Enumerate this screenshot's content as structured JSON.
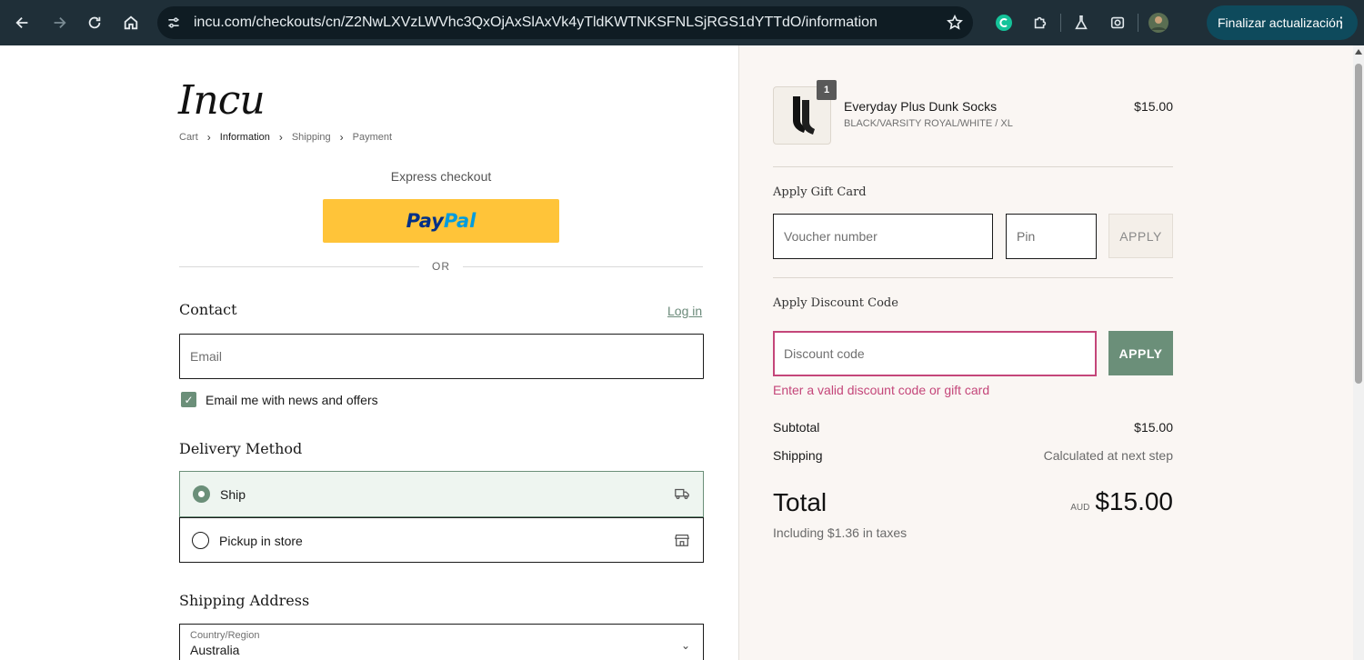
{
  "browser": {
    "url": "incu.com/checkouts/cn/Z2NwLXVzLWVhc3QxOjAxSlAxVk4yTldKWTNKSFNLSjRGS1dYTTdO/information",
    "update_label": "Finalizar actualización"
  },
  "brand": {
    "logo_text": "Incu"
  },
  "breadcrumb": [
    "Cart",
    "Information",
    "Shipping",
    "Payment"
  ],
  "express": {
    "label": "Express checkout",
    "paypal_pay": "Pay",
    "paypal_pal": "Pal",
    "or": "OR"
  },
  "contact": {
    "heading": "Contact",
    "login_label": "Log in",
    "email_placeholder": "Email",
    "newsletter_label": "Email me with news and offers",
    "newsletter_checked": true
  },
  "delivery": {
    "heading": "Delivery Method",
    "options": [
      {
        "label": "Ship",
        "selected": true,
        "icon": "truck-icon"
      },
      {
        "label": "Pickup in store",
        "selected": false,
        "icon": "store-icon"
      }
    ]
  },
  "shipping": {
    "heading": "Shipping Address",
    "country_label": "Country/Region",
    "country_value": "Australia"
  },
  "order": {
    "item": {
      "quantity": "1",
      "name": "Everyday Plus Dunk Socks",
      "variant": "BLACK/VARSITY ROYAL/WHITE / XL",
      "price": "$15.00"
    },
    "gift_card": {
      "heading": "Apply Gift Card",
      "voucher_placeholder": "Voucher number",
      "pin_placeholder": "Pin",
      "apply_label": "APPLY"
    },
    "discount": {
      "heading": "Apply Discount Code",
      "placeholder": "Discount code",
      "apply_label": "APPLY",
      "error": "Enter a valid discount code or gift card"
    },
    "subtotal_label": "Subtotal",
    "subtotal_value": "$15.00",
    "shipping_label": "Shipping",
    "shipping_value": "Calculated at next step",
    "total_label": "Total",
    "currency": "AUD",
    "total_value": "$15.00",
    "tax_note": "Including $1.36 in taxes"
  },
  "colors": {
    "accent": "#6b8f79",
    "error": "#c4467a",
    "paypal": "#ffc439",
    "chrome": "#1f2f38"
  }
}
